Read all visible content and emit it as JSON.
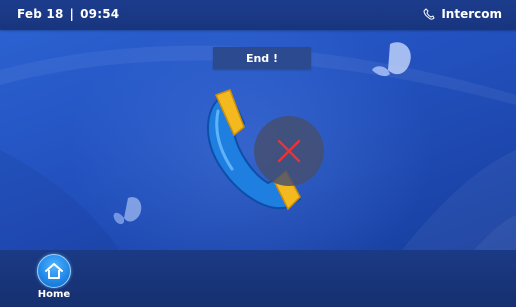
{
  "header": {
    "date": "Feb 18",
    "time": "09:54",
    "app_title": "Intercom",
    "app_icon": "intercom-icon"
  },
  "call": {
    "status": "End !",
    "phone_icon": "phone-handset-icon",
    "end_icon": "close-x-icon"
  },
  "footer": {
    "home_label": "Home",
    "home_icon": "home-icon"
  },
  "colors": {
    "accent_blue": "#2352c0",
    "end_x_red": "#e8333b",
    "handset_blue": "#1f7fe0",
    "handset_yellow": "#f3b91f"
  }
}
